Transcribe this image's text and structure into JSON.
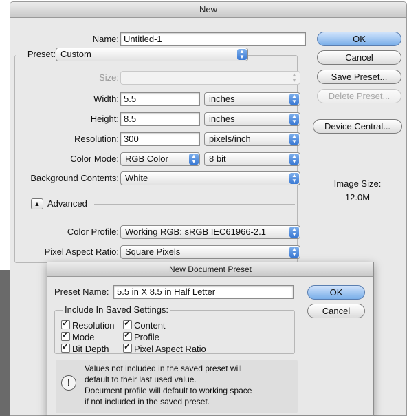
{
  "main_dialog": {
    "title": "New",
    "name_label": "Name:",
    "name_value": "Untitled-1",
    "preset_label": "Preset:",
    "preset_value": "Custom",
    "size_label": "Size:",
    "size_value": "",
    "width_label": "Width:",
    "width_value": "5.5",
    "width_unit": "inches",
    "height_label": "Height:",
    "height_value": "8.5",
    "height_unit": "inches",
    "resolution_label": "Resolution:",
    "resolution_value": "300",
    "resolution_unit": "pixels/inch",
    "color_mode_label": "Color Mode:",
    "color_mode_value": "RGB Color",
    "bit_depth_value": "8 bit",
    "background_label": "Background Contents:",
    "background_value": "White",
    "advanced_label": "Advanced",
    "color_profile_label": "Color Profile:",
    "color_profile_value": "Working RGB:  sRGB IEC61966-2.1",
    "pixel_aspect_label": "Pixel Aspect Ratio:",
    "pixel_aspect_value": "Square Pixels",
    "buttons": {
      "ok": "OK",
      "cancel": "Cancel",
      "save_preset": "Save Preset...",
      "delete_preset": "Delete Preset...",
      "device_central": "Device Central..."
    },
    "image_size_label": "Image Size:",
    "image_size_value": "12.0M"
  },
  "preset_dialog": {
    "title": "New Document Preset",
    "preset_name_label": "Preset Name:",
    "preset_name_value": "5.5 in X 8.5 in Half Letter",
    "ok": "OK",
    "cancel": "Cancel",
    "group_label": "Include In Saved Settings:",
    "checkboxes": {
      "resolution": "Resolution",
      "content": "Content",
      "mode": "Mode",
      "profile": "Profile",
      "bit_depth": "Bit Depth",
      "pixel_aspect_ratio": "Pixel Aspect Ratio"
    },
    "note_line1": "Values not included in the saved preset will",
    "note_line2": "default to their last used value.",
    "note_line3": "Document profile will default to working space",
    "note_line4": "if not included in the saved preset."
  },
  "colors": {
    "dialog_bg": "#e9e9e9",
    "default_button": "#79aee9",
    "popup_arrow": "#3a79d4",
    "dim_backdrop": "#6a6a6a"
  }
}
